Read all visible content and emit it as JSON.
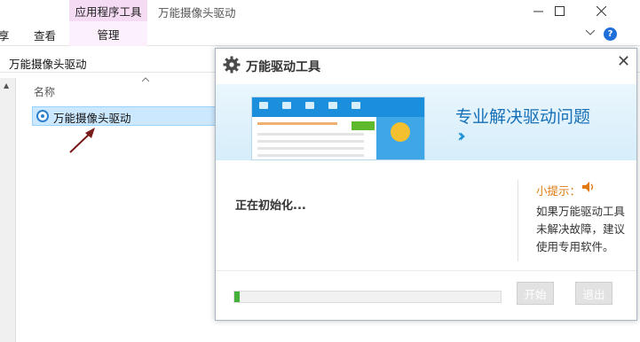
{
  "explorer": {
    "context_tab": "应用程序工具",
    "window_title": "万能摄像头驱动",
    "ribbon_tabs": [
      "享",
      "查看",
      "管理"
    ],
    "address": "万能摄像头驱动",
    "column_header": "名称",
    "file_name": "万能摄像头驱动",
    "window_controls": [
      "minimize-icon",
      "maximize-icon",
      "close-icon"
    ],
    "help_label": "?"
  },
  "dialog": {
    "title": "万能驱动工具",
    "close_label": "✕",
    "banner_text": "专业解决驱动问题",
    "banner_arrows": "››",
    "status_text": "正在初始化...",
    "tip_title": "小提示：",
    "tip_lines": [
      "如果万能驱动工具",
      "未解决故障，建议",
      "使用专用软件。"
    ],
    "progress": 0.02,
    "buttons": {
      "start": "开始",
      "exit": "退出"
    }
  },
  "colors": {
    "accent": "#1b8fdb",
    "tip": "#e07a10",
    "progress": "#45b13a",
    "context_tab": "#f5dcf4"
  }
}
